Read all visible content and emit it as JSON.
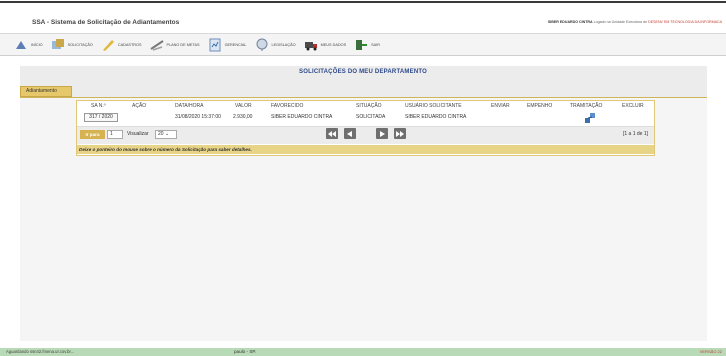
{
  "app": {
    "title": "SSA - Sistema de Solicitação de Adiantamentos",
    "user_prefix": "",
    "user_name": "SIBER EDUARDO CINTRA",
    "user_mid": " Logado na Unidade Executora de ",
    "user_unit": "DESENV EM TECNOLOGIA DA INFORMACA"
  },
  "toolbar": {
    "items": [
      {
        "label": "Início",
        "icon": "home-icon"
      },
      {
        "label": "Solicitação",
        "icon": "request-icon"
      },
      {
        "label": "Cadastros",
        "icon": "pencil-icon"
      },
      {
        "label": "Plano de Metas",
        "icon": "goals-icon"
      },
      {
        "label": "Gerencial",
        "icon": "report-icon"
      },
      {
        "label": "Legislação",
        "icon": "law-icon"
      },
      {
        "label": "Meus Dados",
        "icon": "truck-icon"
      },
      {
        "label": "Sair",
        "icon": "exit-icon"
      }
    ]
  },
  "page": {
    "title": "SOLICITAÇÕES DO MEU DEPARTAMENTO",
    "tab_label": "Adiantamento"
  },
  "table": {
    "headers": [
      "SA N.º",
      "AÇÃO",
      "DATA/HORA",
      "VALOR",
      "FAVORECIDO",
      "SITUAÇÃO",
      "USUÁRIO SOLICITANTE",
      "ENVIAR",
      "EMPENHO",
      "TRAMITAÇÃO",
      "EXCLUIR"
    ],
    "rows": [
      {
        "sa": "317 / 2020",
        "acao": "",
        "data_hora": "31/08/2020 15:37:00",
        "valor": "2.930,00",
        "favorecido": "SIBER EDUARDO CINTRA",
        "situacao": "SOLICITADA",
        "usuario": "SIBER EDUARDO CINTRA",
        "tramitacao_icon": "routing-icon"
      }
    ]
  },
  "pager": {
    "goto_label": "Ir para",
    "page_value": "1",
    "view_label": "Visualizar",
    "per_page": "20",
    "range": "[1 a 1 de 1]"
  },
  "hint": "Deixe o ponteiro do mouse sobre o número da Solicitação para saber detalhes.",
  "status": {
    "left": "Aguardando ssn42.fmena.ur.cov.br...",
    "middle": "paulo - SP.",
    "right": "VERSÃO 22"
  },
  "colors": {
    "accent": "#d6b350",
    "title_blue": "#2e4a8a",
    "status_bar": "#b9dab6"
  }
}
